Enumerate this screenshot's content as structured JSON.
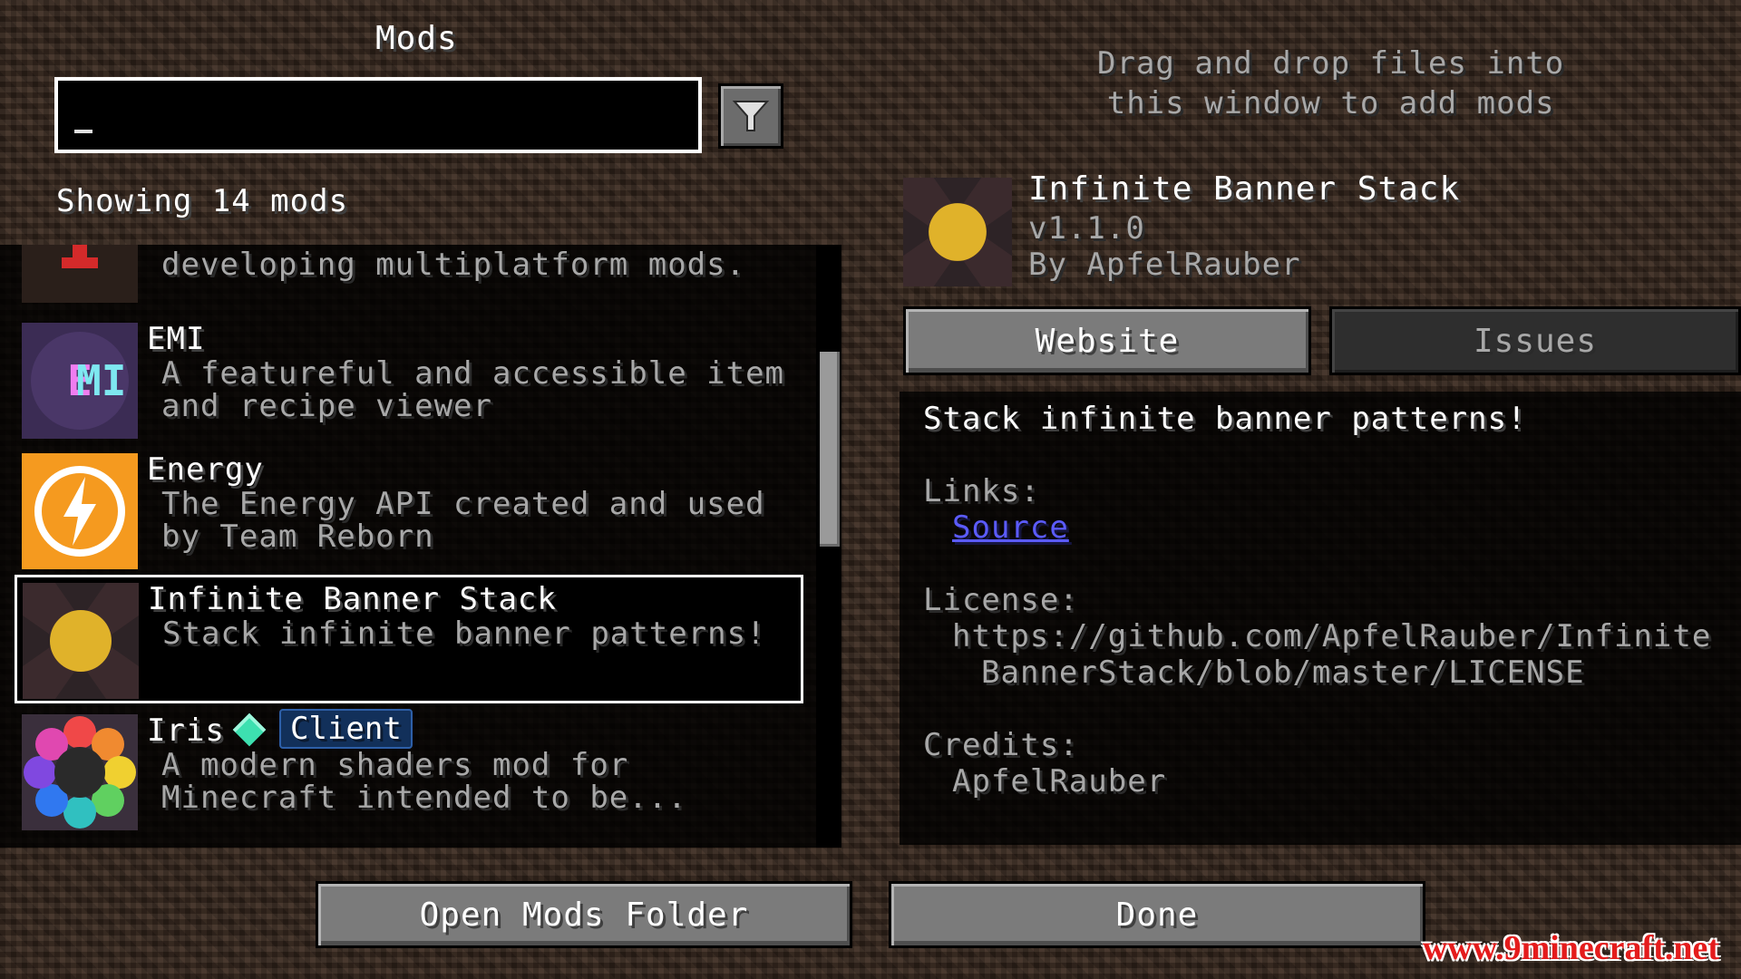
{
  "header": {
    "title": "Mods",
    "search_value": "_",
    "showing_text": "Showing 14 mods"
  },
  "mods": [
    {
      "name": "",
      "desc_line1": "developing multiplatform mods.",
      "desc_line2": "",
      "icon": "architectury-icon"
    },
    {
      "name": "EMI",
      "desc_line1": "A featureful and accessible item",
      "desc_line2": "and recipe viewer",
      "icon": "emi-icon"
    },
    {
      "name": "Energy",
      "desc_line1": "The Energy API created and used",
      "desc_line2": "by Team Reborn",
      "icon": "energy-icon"
    },
    {
      "name": "Infinite Banner Stack",
      "desc_line1": "Stack infinite banner patterns!",
      "desc_line2": "",
      "icon": "banner-icon"
    },
    {
      "name": "Iris",
      "badge": "Client",
      "desc_line1": "A modern shaders mod for",
      "desc_line2": "Minecraft intended to be...",
      "icon": "iris-icon"
    }
  ],
  "drop_hint": {
    "line1": "Drag and drop files into",
    "line2": "this window to add mods"
  },
  "details": {
    "name": "Infinite Banner Stack",
    "version": "v1.1.0",
    "author": "By ApfelRauber",
    "website_label": "Website",
    "issues_label": "Issues",
    "description": "Stack infinite banner patterns!",
    "links_label": "Links:",
    "source_label": "Source",
    "license_label": "License:",
    "license_line1": "https://github.com/ApfelRauber/Infinite",
    "license_line2": "BannerStack/blob/master/LICENSE",
    "credits_label": "Credits:",
    "credits_value": "ApfelRauber"
  },
  "footer": {
    "open_folder_label": "Open Mods Folder",
    "done_label": "Done"
  },
  "watermark": "www.9minecraft.net",
  "colors": {
    "link": "#5b5bff",
    "gray_text": "#a8a8a8",
    "selection_border": "#ffffff",
    "watermark": "#e41c1c"
  }
}
